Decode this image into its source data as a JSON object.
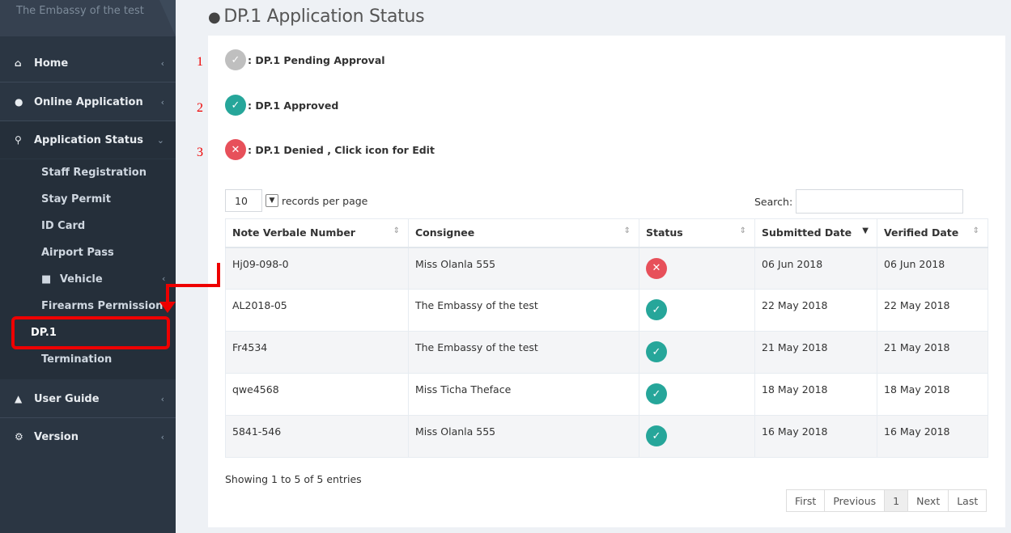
{
  "sidebar": {
    "brand": "The Embassy of the test",
    "items": [
      {
        "label": "Home",
        "icon": "home-icon"
      },
      {
        "label": "Online Application",
        "icon": "user-icon"
      },
      {
        "label": "Application Status",
        "icon": "search-icon"
      },
      {
        "label": "User Guide",
        "icon": "users-icon"
      },
      {
        "label": "Version",
        "icon": "gears-icon"
      }
    ],
    "sub_items": [
      {
        "label": "Staff Registration"
      },
      {
        "label": "Stay Permit"
      },
      {
        "label": "ID Card"
      },
      {
        "label": "Airport Pass"
      },
      {
        "label": "Vehicle"
      },
      {
        "label": "Firearms Permission"
      },
      {
        "label": "DP.1"
      },
      {
        "label": "Termination"
      }
    ]
  },
  "page": {
    "title": "DP.1 Application Status"
  },
  "legend": [
    {
      "number": "1",
      "label": ": DP.1 Pending Approval",
      "status": "pending"
    },
    {
      "number": "2",
      "label": ": DP.1 Approved",
      "status": "approved"
    },
    {
      "number": "3",
      "label": ": DP.1 Denied , Click icon for Edit",
      "status": "denied"
    }
  ],
  "table_controls": {
    "page_size": "10",
    "records_label": "records per page",
    "search_label": "Search:",
    "search_value": ""
  },
  "table": {
    "headers": [
      "Note Verbale Number",
      "Consignee",
      "Status",
      "Submitted Date",
      "Verified Date"
    ],
    "rows": [
      {
        "number": "Hj09-098-0",
        "consignee": "Miss Olanla 555",
        "status": "denied",
        "submitted": "06 Jun 2018",
        "verified": "06 Jun 2018"
      },
      {
        "number": "AL2018-05",
        "consignee": "The Embassy of the test",
        "status": "approved",
        "submitted": "22 May 2018",
        "verified": "22 May 2018"
      },
      {
        "number": "Fr4534",
        "consignee": "The Embassy of the test",
        "status": "approved",
        "submitted": "21 May 2018",
        "verified": "21 May 2018"
      },
      {
        "number": "qwe4568",
        "consignee": "Miss Ticha Theface",
        "status": "approved",
        "submitted": "18 May 2018",
        "verified": "18 May 2018"
      },
      {
        "number": "5841-546",
        "consignee": "Miss Olanla 555",
        "status": "approved",
        "submitted": "16 May 2018",
        "verified": "16 May 2018"
      }
    ]
  },
  "footer": {
    "showing": "Showing 1 to 5 of 5 entries",
    "pager": [
      "First",
      "Previous",
      "1",
      "Next",
      "Last"
    ]
  },
  "colors": {
    "sidebar": "#2b3643",
    "approved": "#26a69a",
    "denied": "#e7505a",
    "pending": "#bfbfbf",
    "annotation": "#e00000"
  }
}
